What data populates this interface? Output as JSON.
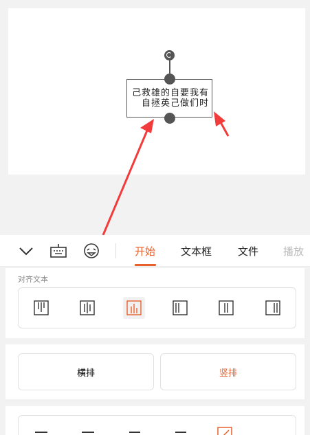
{
  "slide": {
    "textbox_lines": [
      "己救雄的自要我有",
      "自拯英己做们时"
    ]
  },
  "toolbar": {
    "icons": [
      "collapse-chevron-icon",
      "keyboard-icon",
      "emoji-face-icon"
    ],
    "tabs": [
      {
        "label": "开始",
        "active": true
      },
      {
        "label": "文本框",
        "active": false
      },
      {
        "label": "文件",
        "active": false
      },
      {
        "label": "播放",
        "active": false
      }
    ]
  },
  "align_text": {
    "label": "对齐文本",
    "options": [
      {
        "name": "align-top-icon",
        "active": false
      },
      {
        "name": "align-middle-icon",
        "active": false
      },
      {
        "name": "align-bottom-icon",
        "active": true
      },
      {
        "name": "align-left-icon",
        "active": false
      },
      {
        "name": "align-center-icon",
        "active": false
      },
      {
        "name": "align-right-icon",
        "active": false
      }
    ]
  },
  "direction": {
    "horizontal": "横排",
    "vertical": "竖排",
    "active": "vertical"
  },
  "colors": {
    "accent": "#e8612c",
    "arrow": "#f23b3b"
  }
}
